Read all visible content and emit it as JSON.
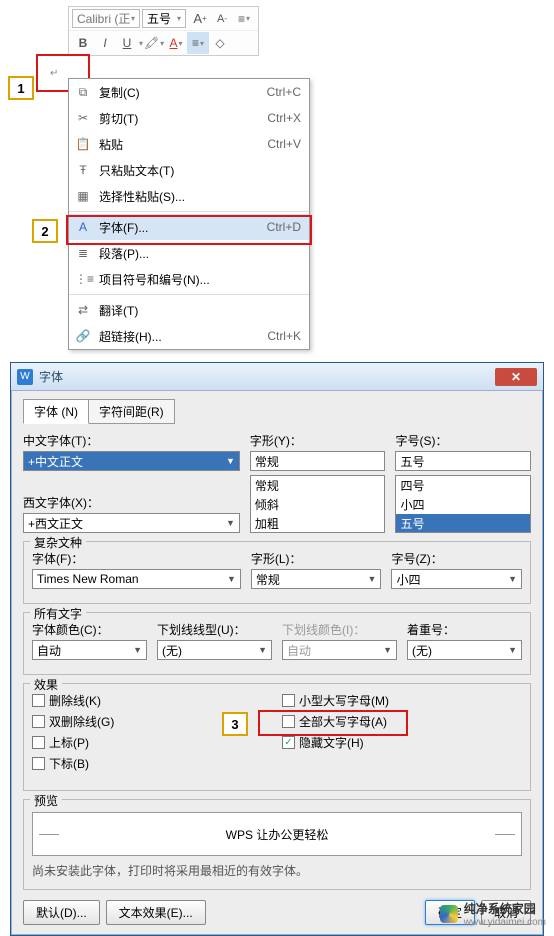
{
  "toolbar": {
    "font": "Calibri (正",
    "size": "五号",
    "bold": "B",
    "italic": "I",
    "underline": "U",
    "aplus": "A",
    "aminus": "A"
  },
  "callouts": {
    "c1": "1",
    "c2": "2",
    "c3": "3"
  },
  "menu": {
    "copy": {
      "label": "复制(C)",
      "shortcut": "Ctrl+C"
    },
    "cut": {
      "label": "剪切(T)",
      "shortcut": "Ctrl+X"
    },
    "paste": {
      "label": "粘贴",
      "shortcut": "Ctrl+V"
    },
    "pastetext": {
      "label": "只粘贴文本(T)"
    },
    "pastespecial": {
      "label": "选择性粘贴(S)..."
    },
    "font": {
      "label": "字体(F)...",
      "shortcut": "Ctrl+D"
    },
    "paragraph": {
      "label": "段落(P)..."
    },
    "bullets": {
      "label": "项目符号和编号(N)..."
    },
    "translate": {
      "label": "翻译(T)"
    },
    "hyperlink": {
      "label": "超链接(H)...",
      "shortcut": "Ctrl+K"
    }
  },
  "dialog": {
    "title": "字体",
    "tabs": {
      "font": "字体 (N)",
      "spacing": "字符间距(R)"
    },
    "cjk_label": "中文字体(T)：",
    "cjk_value": "+中文正文",
    "latin_label": "西文字体(X)：",
    "latin_value": "+西文正文",
    "style_label": "字形(Y)：",
    "style_value": "常规",
    "style_opts": [
      "常规",
      "倾斜",
      "加粗"
    ],
    "size_label": "字号(S)：",
    "size_value": "五号",
    "size_opts": [
      "四号",
      "小四",
      "五号"
    ],
    "complex_legend": "复杂文种",
    "cfont_label": "字体(F)：",
    "cfont_value": "Times New Roman",
    "cstyle_label": "字形(L)：",
    "cstyle_value": "常规",
    "csize_label": "字号(Z)：",
    "csize_value": "小四",
    "alltext_legend": "所有文字",
    "color_label": "字体颜色(C)：",
    "color_value": "自动",
    "ustyle_label": "下划线线型(U)：",
    "ustyle_value": "(无)",
    "ucolor_label": "下划线颜色(I)：",
    "ucolor_value": "自动",
    "emph_label": "着重号：",
    "emph_value": "(无)",
    "effects_legend": "效果",
    "strike": "删除线(K)",
    "dstrike": "双删除线(G)",
    "sup": "上标(P)",
    "sub": "下标(B)",
    "smallcaps": "小型大写字母(M)",
    "allcaps": "全部大写字母(A)",
    "hidden": "隐藏文字(H)",
    "preview_legend": "预览",
    "preview_text": "WPS 让办公更轻松",
    "preview_note": "尚未安装此字体，打印时将采用最相近的有效字体。",
    "default_btn": "默认(D)...",
    "effects_btn": "文本效果(E)...",
    "ok": "确定",
    "cancel": "取消"
  },
  "watermark": {
    "brand": "纯净系统家园",
    "url": "www.yidaimei.com"
  }
}
